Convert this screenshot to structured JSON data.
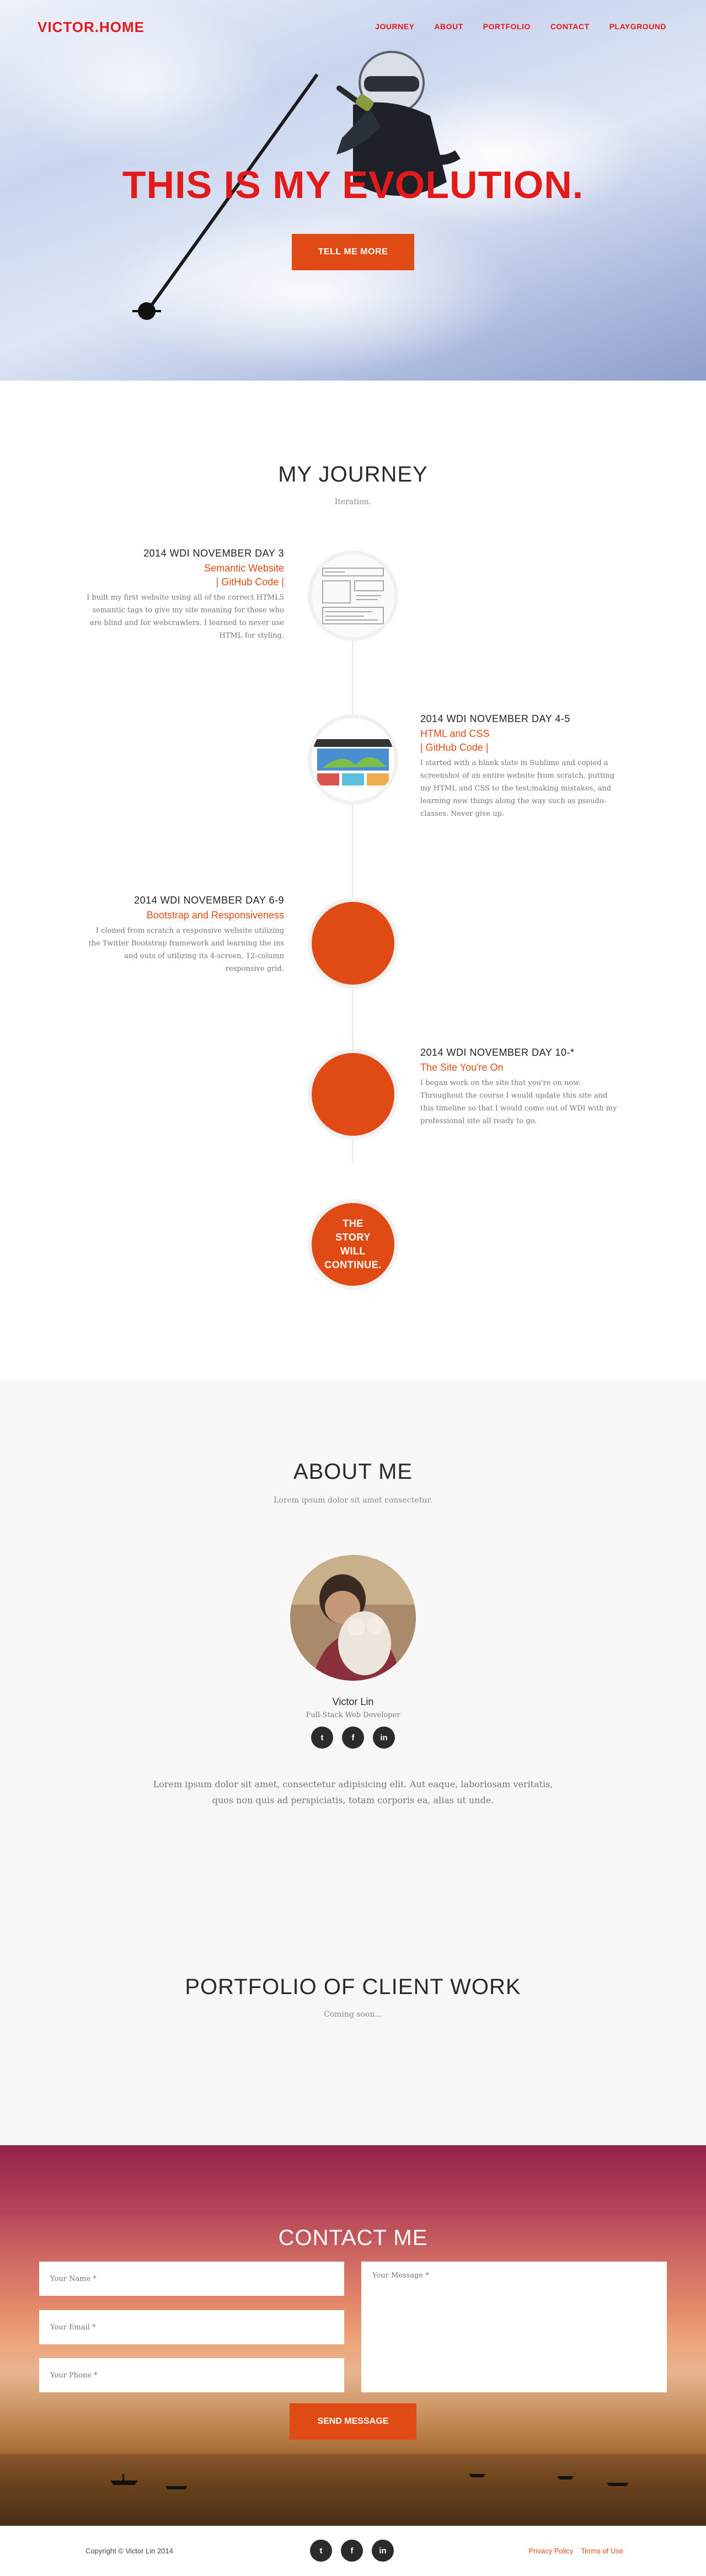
{
  "header": {
    "brand": "VICTOR.HOME",
    "nav": [
      "JOURNEY",
      "ABOUT",
      "PORTFOLIO",
      "CONTACT",
      "PLAYGROUND"
    ]
  },
  "hero": {
    "title": "THIS IS MY EVOLUTION.",
    "button": "TELL ME MORE"
  },
  "journey": {
    "title": "MY JOURNEY",
    "subtitle": "Iteration.",
    "items": [
      {
        "date": "2014 WDI NOVEMBER DAY 3",
        "subtitle": "Semantic Website",
        "link": "| GitHub Code |",
        "desc": "I built my first website using all of the correct HTML5 semantic tags to give my site meaning for those who are blind and for webcrawlers. I learned to never use HTML for styling."
      },
      {
        "date": "2014 WDI NOVEMBER DAY 4-5",
        "subtitle": "HTML and CSS",
        "link": "| GitHub Code |",
        "desc": "I started with a blank slate in Sublime and copied a screenshot of an entire website from scratch, putting my HTML and CSS to the test;making mistakes, and learning new things along the way such as pseudo-classes. Never give up."
      },
      {
        "date": "2014 WDI NOVEMBER DAY 6-9",
        "subtitle": "Bootstrap and Responsiveness",
        "desc": "I cloned from scratch a responsive website utilizing the Twitter Bootstrap framework and learning the ins and outs of utilizing its 4-screen, 12-column responsive grid."
      },
      {
        "date": "2014 WDI NOVEMBER DAY 10-*",
        "subtitle": "The Site You're On",
        "desc": "I began work on the site that you're on now. Throughout the course I would update this site and this timeline so that I would come out of WDI with my professional site all ready to go."
      }
    ],
    "final": "THE STORY WILL CONTINUE."
  },
  "about": {
    "title": "ABOUT ME",
    "subtitle": "Lorem ipsum dolor sit amet consectetur.",
    "name": "Victor Lin",
    "role": "Full-Stack Web Developer",
    "social": [
      "t",
      "f",
      "in"
    ],
    "text": "Lorem ipsum dolor sit amet, consectetur adipisicing elit. Aut eaque, laboriosam veritatis, quos non quis ad perspiciatis, totam corporis ea, alias ut unde."
  },
  "portfolio": {
    "title": "PORTFOLIO OF CLIENT WORK",
    "subtitle": "Coming soon..."
  },
  "contact": {
    "title": "CONTACT ME",
    "name_placeholder": "Your Name *",
    "email_placeholder": "Your Email *",
    "phone_placeholder": "Your Phone *",
    "message_placeholder": "Your Message *",
    "send": "SEND MESSAGE"
  },
  "footer": {
    "copyright": "Copyright © Victor Lin 2014",
    "social": [
      "t",
      "f",
      "in"
    ],
    "privacy": "Privacy Policy",
    "terms": "Terms of Use"
  },
  "colors": {
    "accent": "#e04a14",
    "brand": "#e31a1a",
    "dark": "#2b2b2b"
  }
}
